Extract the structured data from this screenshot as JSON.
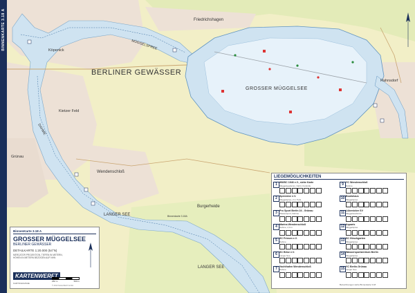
{
  "side_strip": "BINNENKARTE 3.18 A",
  "places": {
    "friedrichshagen": "Friedrichshagen",
    "koepenick": "Köpenick",
    "berliner_gewaesser": "BERLINER GEWÄSSER",
    "muggelspree": "MÜGGELSPREE",
    "grosser_muggelsee": "GROSSER MÜGGELSEE",
    "rahnsdorf": "Rahnsdorf",
    "kietzer_feld": "Kietzer Feld",
    "dahme": "DAHME",
    "gruenau": "Grünau",
    "wendenschloss": "Wendenschloß",
    "langer_see": "LANGER SEE",
    "langer_see_2": "LANGER SEE",
    "burgerheide": "Burgerheide",
    "binnenkarte_ref": "Binnenkarte 3.18A"
  },
  "title_box": {
    "small": "BinnenKarte 3.18 A",
    "main": "GROSSER MÜGGELSEE",
    "sub": "BERLINER GEWÄSSER",
    "scale": "DETAILKARTE 1:20.000 (54°N)",
    "note": "MERCATOR PROJEKTION, TIEFEN IN METERN, HÖHEN IN METERN BEZOGEN AUF NHN",
    "brand": "KARTENWERFT",
    "brand_sub": "KARTOGRAPHIE",
    "scale_left": "250 m",
    "scale_right": "500 m",
    "copyright": "© 2013 KartenWerft GmbH"
  },
  "legend": {
    "heading": "LIEGEMÖGLICHKEITEN",
    "entries": [
      {
        "num": "1",
        "name": "WWSC 1946 e.V., siehe Karte",
        "desc": "Müggelseedamm, Fahrt, Kontrolle"
      },
      {
        "num": "2",
        "name": "Spreenixe e.V.",
        "desc": "Müggelspree, 2 m Tiefe"
      },
      {
        "num": "3",
        "name": "Pro Sport Berlin 24 - Grünau",
        "desc": "Wassersport, Dahme"
      },
      {
        "num": "4",
        "name": "Marina Wendenschloß",
        "desc": "Dahme, 2,0 m"
      },
      {
        "num": "5",
        "name": "SC Friesen e.V.",
        "desc": "Dahme"
      },
      {
        "num": "6",
        "name": "SC Brise e.V.",
        "desc": "Langer See"
      },
      {
        "num": "7",
        "name": "Yachthafen Wendenschloß",
        "desc": "Dahme"
      },
      {
        "num": "9",
        "name": "YC Wendenschloß",
        "desc": "Dahme"
      },
      {
        "num": "10",
        "name": "Bootshaus",
        "desc": "Müggelspree"
      },
      {
        "num": "11",
        "name": "Lübenicker SV",
        "desc": "Müggelseedamm"
      },
      {
        "num": "12",
        "name": "Aquaris",
        "desc": "Müggelspree"
      },
      {
        "num": "13",
        "name": "SC Hirschgarten",
        "desc": "Müggelspree"
      },
      {
        "num": "14",
        "name": "Wassersportzentrum Berlin",
        "desc": "Müggelspree"
      },
      {
        "num": "15",
        "name": "YC Berlin-Grünau",
        "desc": "Langer See"
      }
    ],
    "footer": "Bezeichnungen siehe Binnenkarte 3.18"
  },
  "colors": {
    "water": "#cfe3f1",
    "deep_water": "#e6f1f9",
    "land": "#f4f1c8",
    "forest": "#d9e6b0",
    "urban": "#efe0d8",
    "brand": "#1a2f5a"
  }
}
